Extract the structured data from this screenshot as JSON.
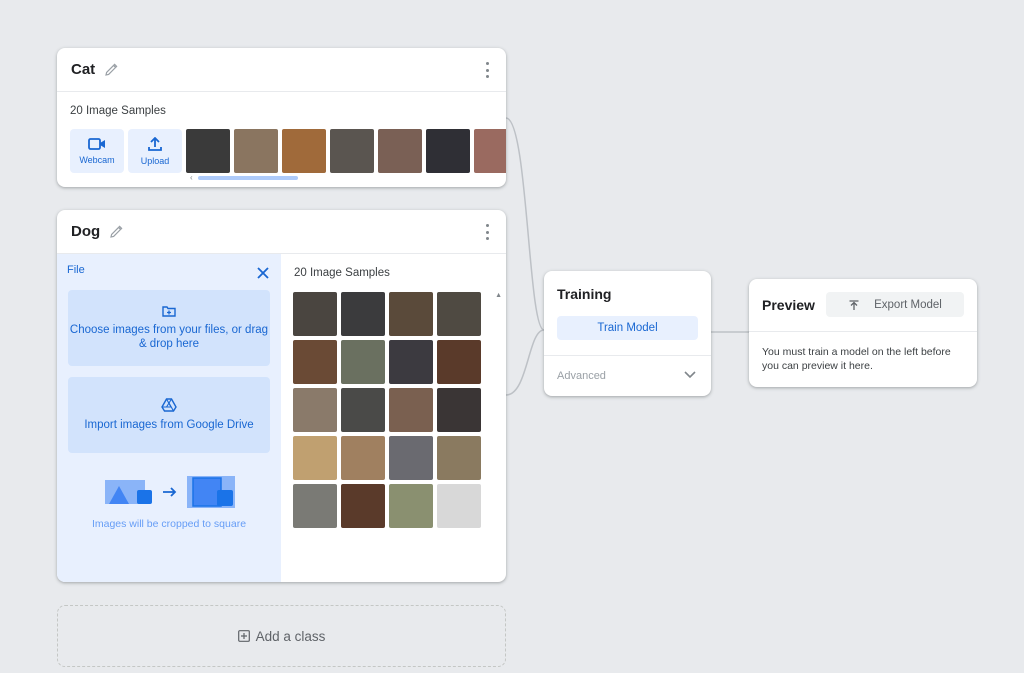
{
  "classes": [
    {
      "name": "Cat",
      "samples_label": "20 Image Samples",
      "actions": {
        "webcam_label": "Webcam",
        "upload_label": "Upload"
      },
      "thumb_colors": [
        "#3a3a3a",
        "#8a7560",
        "#a06a3a",
        "#5a5550",
        "#7a6055",
        "#2f2f35",
        "#9a6a60"
      ]
    },
    {
      "name": "Dog",
      "samples_label": "20 Image Samples",
      "upload_panel": {
        "title": "File",
        "files_prompt": "Choose images from your files, or drag & drop here",
        "drive_prompt": "Import images from Google Drive",
        "crop_note": "Images will be cropped to square"
      },
      "thumb_colors": [
        "#4a4540",
        "#3b3b3d",
        "#5a4a3a",
        "#4f4a42",
        "#6a4a35",
        "#6a7060",
        "#3c3a40",
        "#5a3a2a",
        "#8a7a6a",
        "#4a4a48",
        "#7a6050",
        "#3a3535",
        "#c0a070",
        "#a08060",
        "#6a6a70",
        "#8a7a60",
        "#7a7a75",
        "#5a3a2a",
        "#8a9070",
        "#d8d8d8"
      ]
    }
  ],
  "add_class": {
    "label": "Add a class"
  },
  "training": {
    "title": "Training",
    "train_button": "Train Model",
    "advanced_label": "Advanced"
  },
  "preview": {
    "title": "Preview",
    "export_button": "Export Model",
    "message": "You must train a model on the left before you can preview it here."
  },
  "colors": {
    "accent": "#1967d2",
    "accent_light": "#e8f0fe",
    "background": "#e8eaed"
  }
}
